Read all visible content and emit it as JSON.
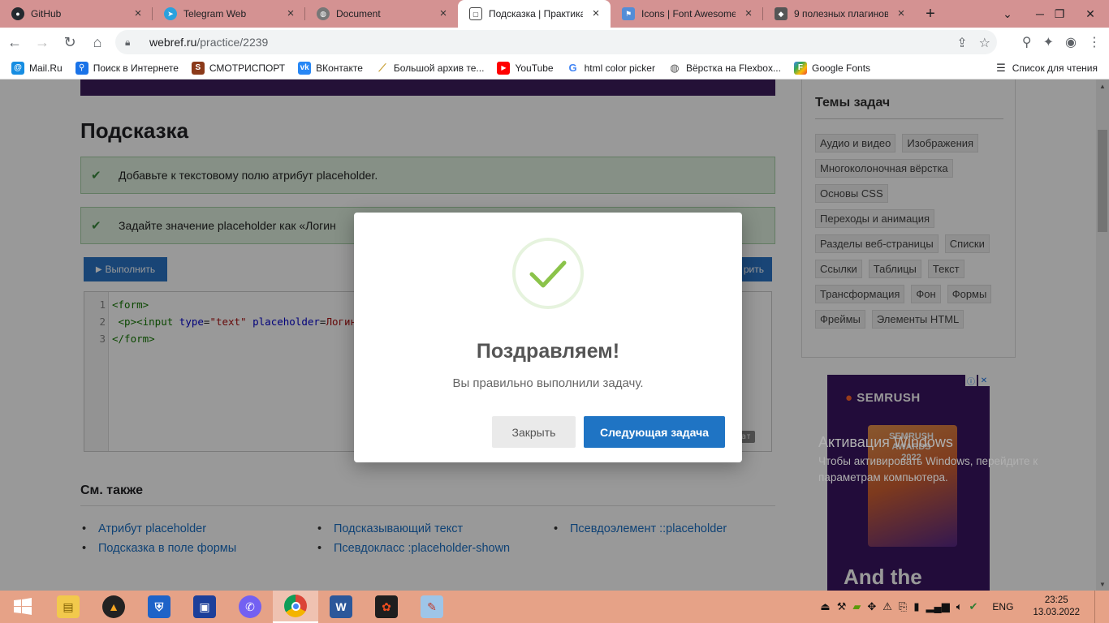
{
  "browser": {
    "tabs": [
      {
        "title": "GitHub",
        "icon": "github-icon",
        "color": "#24292f"
      },
      {
        "title": "Telegram Web",
        "icon": "telegram-icon",
        "color": "#2aa1de"
      },
      {
        "title": "Document",
        "icon": "globe-icon",
        "color": "#777777"
      },
      {
        "title": "Подсказка | Практика",
        "icon": "webref-icon",
        "color": "#444444",
        "active": true
      },
      {
        "title": "Icons | Font Awesome",
        "icon": "fontawesome-icon",
        "color": "#538dd7"
      },
      {
        "title": "9 полезных плагинов",
        "icon": "shield-icon",
        "color": "#555555"
      }
    ],
    "url_domain": "webref.ru",
    "url_path": "/practice/2239",
    "bookmarks": [
      {
        "label": "Mail.Ru",
        "icon": "mailru-icon",
        "color": "#168de2"
      },
      {
        "label": "Поиск в Интернете",
        "icon": "search-icon",
        "color": "#1a73e8"
      },
      {
        "label": "СМОТРИСПОРТ",
        "icon": "smotrisport-icon",
        "color": "#8b3a1a"
      },
      {
        "label": "ВКонтакте",
        "icon": "vk-icon",
        "color": "#2787f5"
      },
      {
        "label": "Большой архив те...",
        "icon": "broom-icon",
        "color": "#c9a23a"
      },
      {
        "label": "YouTube",
        "icon": "youtube-icon",
        "color": "#ff0000"
      },
      {
        "label": "html color picker",
        "icon": "google-icon",
        "color": "#4285f4"
      },
      {
        "label": "Вёрстка на Flexbox...",
        "icon": "globe-icon",
        "color": "#555555"
      },
      {
        "label": "Google Fonts",
        "icon": "google-fonts-icon",
        "color": "#34a853"
      }
    ],
    "reading_list": "Список для чтения"
  },
  "page": {
    "title": "Подсказка",
    "tasks": [
      {
        "text": "Добавьте к текстовому полю атрибут placeholder."
      },
      {
        "text": "Задайте значение placeholder как «Логин"
      }
    ],
    "run_button": "Выполнить",
    "reset_button": "рить",
    "result_badge": "ат",
    "code_lines": [
      "1",
      "2",
      "3"
    ],
    "see_also_title": "См. также",
    "see_also": [
      "Атрибут placeholder",
      "Подсказывающий текст",
      "Псевдоэлемент ::placeholder",
      "Подсказка в поле формы",
      "Псевдокласс :placeholder-shown"
    ],
    "sidebar_title": "Темы задач",
    "topics": [
      "Аудио и видео",
      "Изображения",
      "Многоколоночная вёрстка",
      "Основы CSS",
      "Переходы и анимация",
      "Разделы веб-страницы",
      "Списки",
      "Ссылки",
      "Таблицы",
      "Текст",
      "Трансформация",
      "Фон",
      "Формы",
      "Фреймы",
      "Элементы HTML"
    ],
    "ad": {
      "brand": "SEMRUSH",
      "award_line1": "SEMRUSH",
      "award_line2": "AWARDS",
      "award_line3": "2022",
      "tagline": "And the"
    },
    "activation_title": "Активация Windows",
    "activation_line1": "Чтобы активировать Windows, перейдите к",
    "activation_line2": "параметрам компьютера."
  },
  "modal": {
    "title": "Поздравляем!",
    "text": "Вы правильно выполнили задачу.",
    "close_button": "Закрыть",
    "next_button": "Следующая задача",
    "accent": "#1f74c4",
    "check_color": "#8bc34a"
  },
  "taskbar": {
    "language": "ENG",
    "time": "23:25",
    "date": "13.03.2022"
  }
}
